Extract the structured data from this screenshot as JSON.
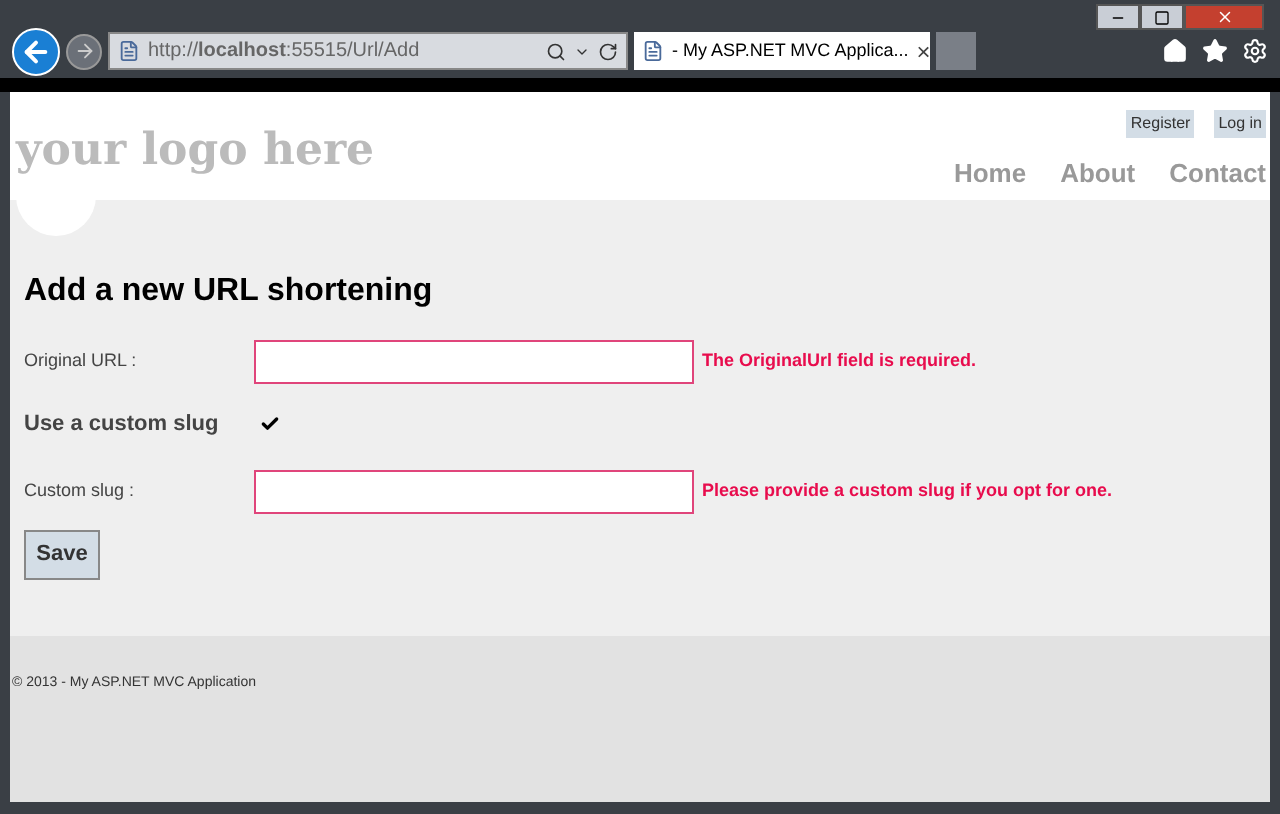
{
  "browser": {
    "address": "http://**localhost**:55515/Url/Add",
    "tab_title": "- My ASP.NET MVC Applica...",
    "tab_close": "×"
  },
  "header": {
    "logo": "your logo here",
    "account_links": [
      "Register",
      "Log in"
    ],
    "nav": [
      "Home",
      "About",
      "Contact"
    ]
  },
  "form": {
    "title": "Add a new URL shortening",
    "fields": [
      {
        "kind": "text",
        "label": "Original URL :",
        "error": "The OriginalUrl field is required."
      },
      {
        "kind": "checkbox",
        "label": "Use a custom slug",
        "checked": true
      },
      {
        "kind": "text",
        "label": "Custom slug :",
        "error": "Please provide a custom slug if you opt for one."
      }
    ],
    "submit": "Save"
  },
  "footer": "© 2013 - My ASP.NET MVC Application"
}
